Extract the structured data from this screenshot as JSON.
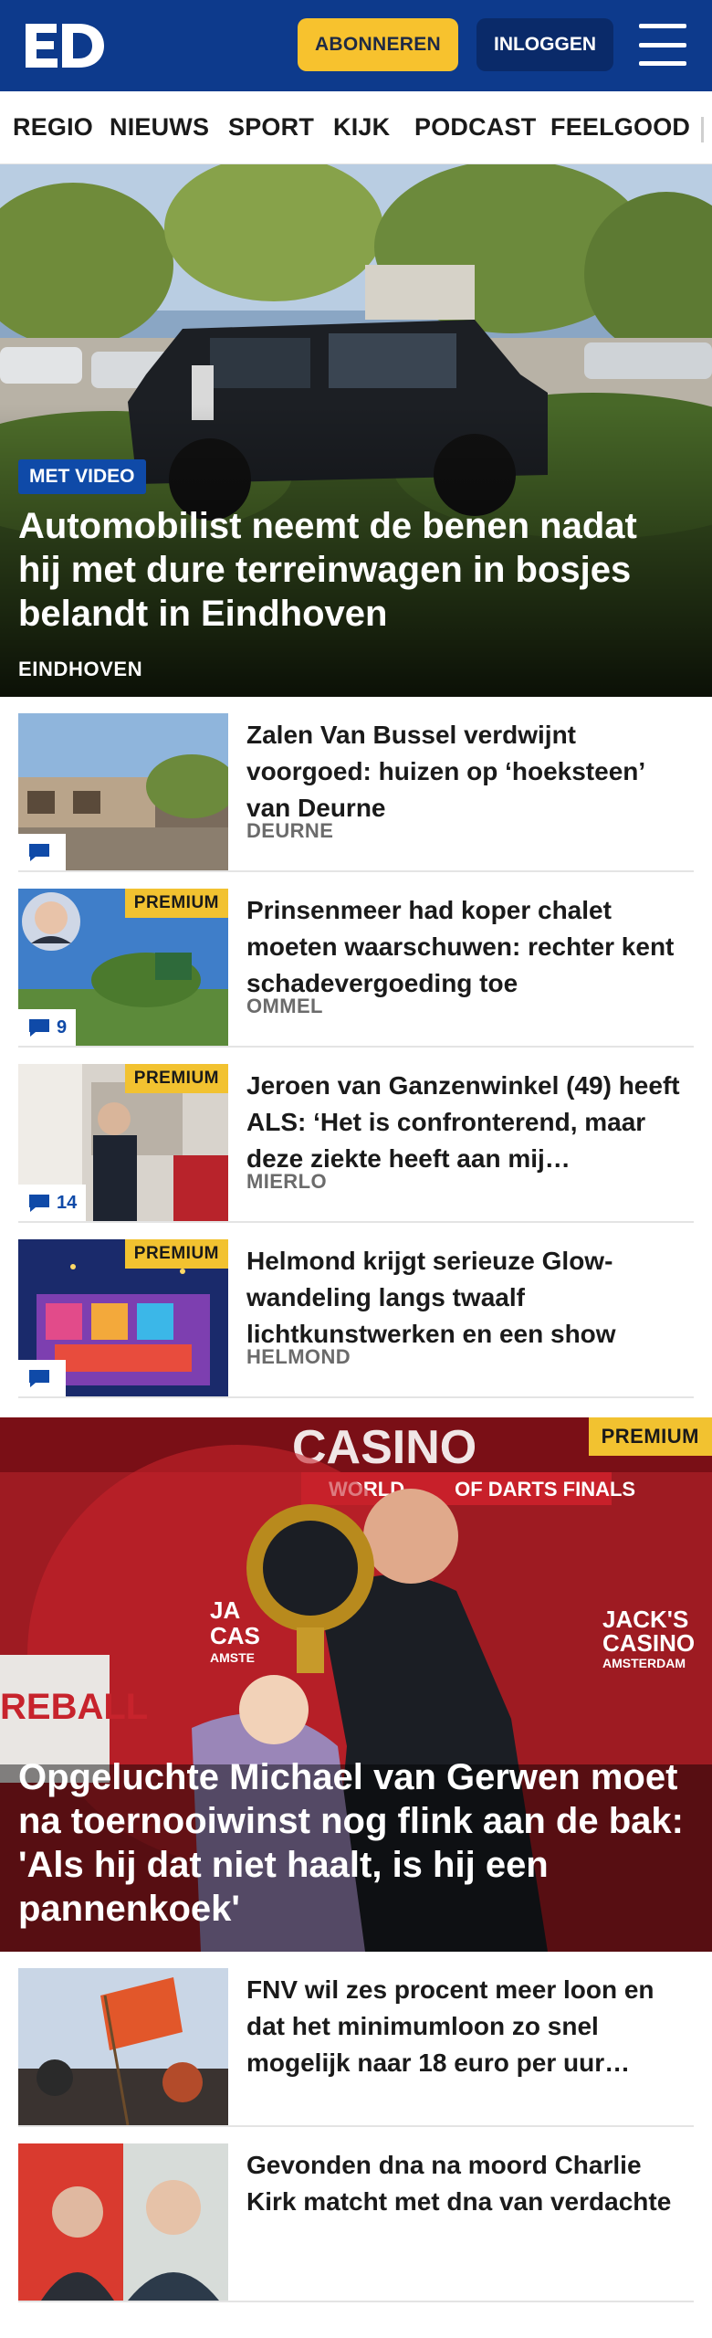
{
  "header": {
    "logo_text": "ED",
    "subscribe_label": "ABONNEREN",
    "login_label": "INLOGGEN",
    "brand_color": "#0d3a8c",
    "accent_color": "#f7c22e"
  },
  "nav": {
    "items": [
      {
        "label": "REGIO"
      },
      {
        "label": "NIEUWS"
      },
      {
        "label": "SPORT"
      },
      {
        "label": "KIJK"
      },
      {
        "label": "PODCAST"
      },
      {
        "label": "FEELGOOD"
      }
    ]
  },
  "hero": {
    "badge": "MET VIDEO",
    "title": "Automobilist neemt de benen nadat hij met dure terreinwagen in bosjes belandt in Eindhoven",
    "location": "EINDHOVEN"
  },
  "articles": [
    {
      "title": "Zalen Van Bussel verdwijnt voorgoed: huizen op ‘hoeksteen’ van Deurne",
      "location": "DEURNE",
      "comments": "",
      "premium": ""
    },
    {
      "title": "Prinsenmeer had koper chalet moeten waarschuwen: rechter kent schadevergoeding toe",
      "location": "OMMEL",
      "comments": "9",
      "premium": "PREMIUM"
    },
    {
      "title": "Jeroen van Ganzenwinkel (49) heeft ALS: ‘Het is confronterend, maar deze ziekte heeft aan mij…",
      "location": "MIERLO",
      "comments": "14",
      "premium": "PREMIUM"
    },
    {
      "title": "Helmond krijgt serieuze Glow-wandeling langs twaalf lichtkunstwerken en een show",
      "location": "HELMOND",
      "comments": "",
      "premium": "PREMIUM"
    }
  ],
  "big_story": {
    "premium": "PREMIUM",
    "title": "Opgeluchte Michael van Gerwen moet na toernooiwinst nog flink aan de bak: 'Als hij dat niet haalt, is hij een pannenkoek'",
    "image_text_top": "CASINO",
    "image_text_banner": "WORLD         OF DARTS FINALS",
    "image_text_jacks": "JACK'S",
    "image_text_casino": "CASINO",
    "image_text_amsterdam": "AMSTERDAM",
    "image_text_left1": "JA",
    "image_text_left2": "CAS",
    "image_text_left3": "AMSTE",
    "image_text_reball": "REBALL"
  },
  "articles2": [
    {
      "title": "FNV wil zes procent meer loon en dat het minimumloon zo snel mogelijk naar 18 euro per uur…"
    },
    {
      "title": "Gevonden dna na moord Charlie Kirk matcht met dna van verdachte"
    }
  ]
}
